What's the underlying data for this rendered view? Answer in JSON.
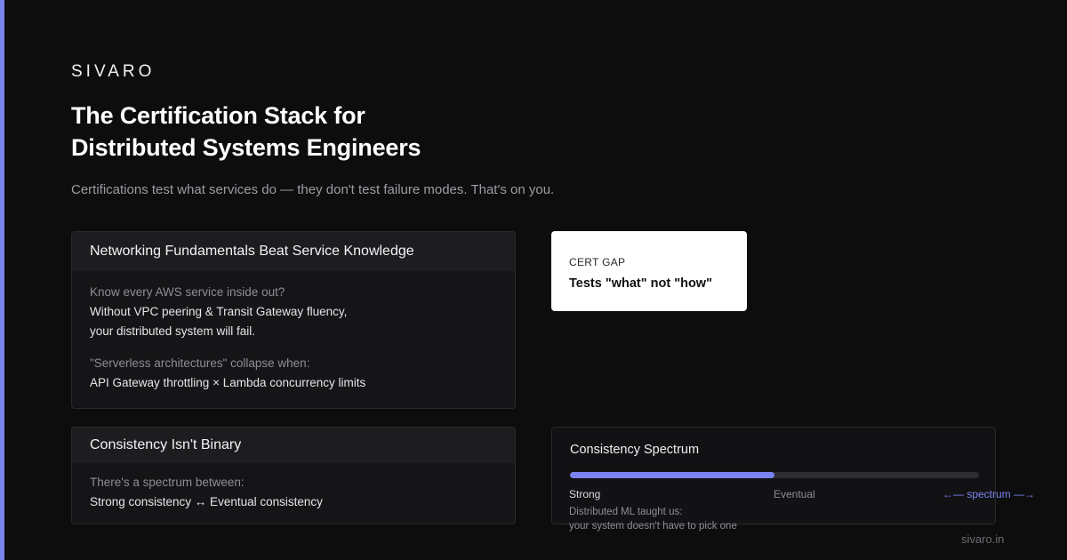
{
  "brand": "SIVARO",
  "headline": {
    "line1": "The Certification Stack for",
    "line2": "Distributed Systems Engineers"
  },
  "subtitle": "Certifications test what services do — they don't test failure modes. That's on you.",
  "networking_card": {
    "title": "Networking Fundamentals Beat Service Knowledge",
    "question": "Know every AWS service inside out?",
    "line1": "Without VPC peering & Transit Gateway fluency,",
    "line2": "your distributed system will fail.",
    "quote": "\"Serverless architectures\" collapse when:",
    "limits": "API Gateway throttling × Lambda concurrency limits"
  },
  "cert_gap": {
    "label": "CERT GAP",
    "text": "Tests \"what\" not \"how\""
  },
  "consistency_card": {
    "title": "Consistency Isn't Binary",
    "intro": "There's a spectrum between:",
    "range": "Strong consistency ↔ Eventual consistency"
  },
  "spectrum": {
    "title": "Consistency Spectrum",
    "fill_fraction": 0.5,
    "strong_label": "Strong",
    "eventual_label": "Eventual",
    "arrow_label": "←— spectrum —→",
    "note_line1": "Distributed ML taught us:",
    "note_line2": "your system doesn't have to pick one"
  },
  "footer_domain": "sivaro.in",
  "colors": {
    "accent": "#7b83ee",
    "background": "#0d0d0e",
    "card": "#151517",
    "card_header": "#1d1d20"
  }
}
